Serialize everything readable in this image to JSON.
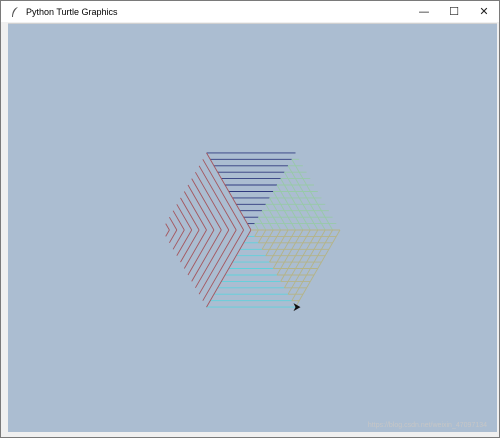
{
  "window": {
    "title": "Python Turtle Graphics",
    "icon": "feather-icon",
    "controls": {
      "minimize": "—",
      "maximize": "☐",
      "close": "✕"
    }
  },
  "canvas": {
    "background": "#abbdd1",
    "drawing": {
      "shape": "hexagon made of three nested-rhombus groups",
      "colors": {
        "top": "#2f3a7e",
        "left": "#a4565e",
        "right_upper": "#98c9a8",
        "right_lower": "#b4b488",
        "bottom": "#5fd2dc"
      },
      "turtle_color": "#111111"
    }
  },
  "watermark": "https://blog.csdn.net/weixin_47097134"
}
